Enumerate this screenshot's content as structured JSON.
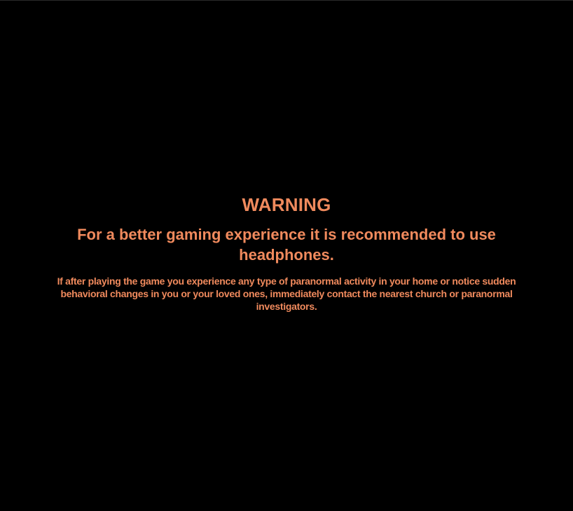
{
  "colors": {
    "background": "#000000",
    "text": "#f08a5d"
  },
  "warning": {
    "title": "WARNING",
    "headphones_note": "For a better gaming experience it is recommended to use headphones.",
    "disclaimer": "If after playing the game you experience any type of paranormal activity in your home or notice sudden behavioral changes in you or your loved ones, immediately contact the nearest church or paranormal investigators."
  }
}
